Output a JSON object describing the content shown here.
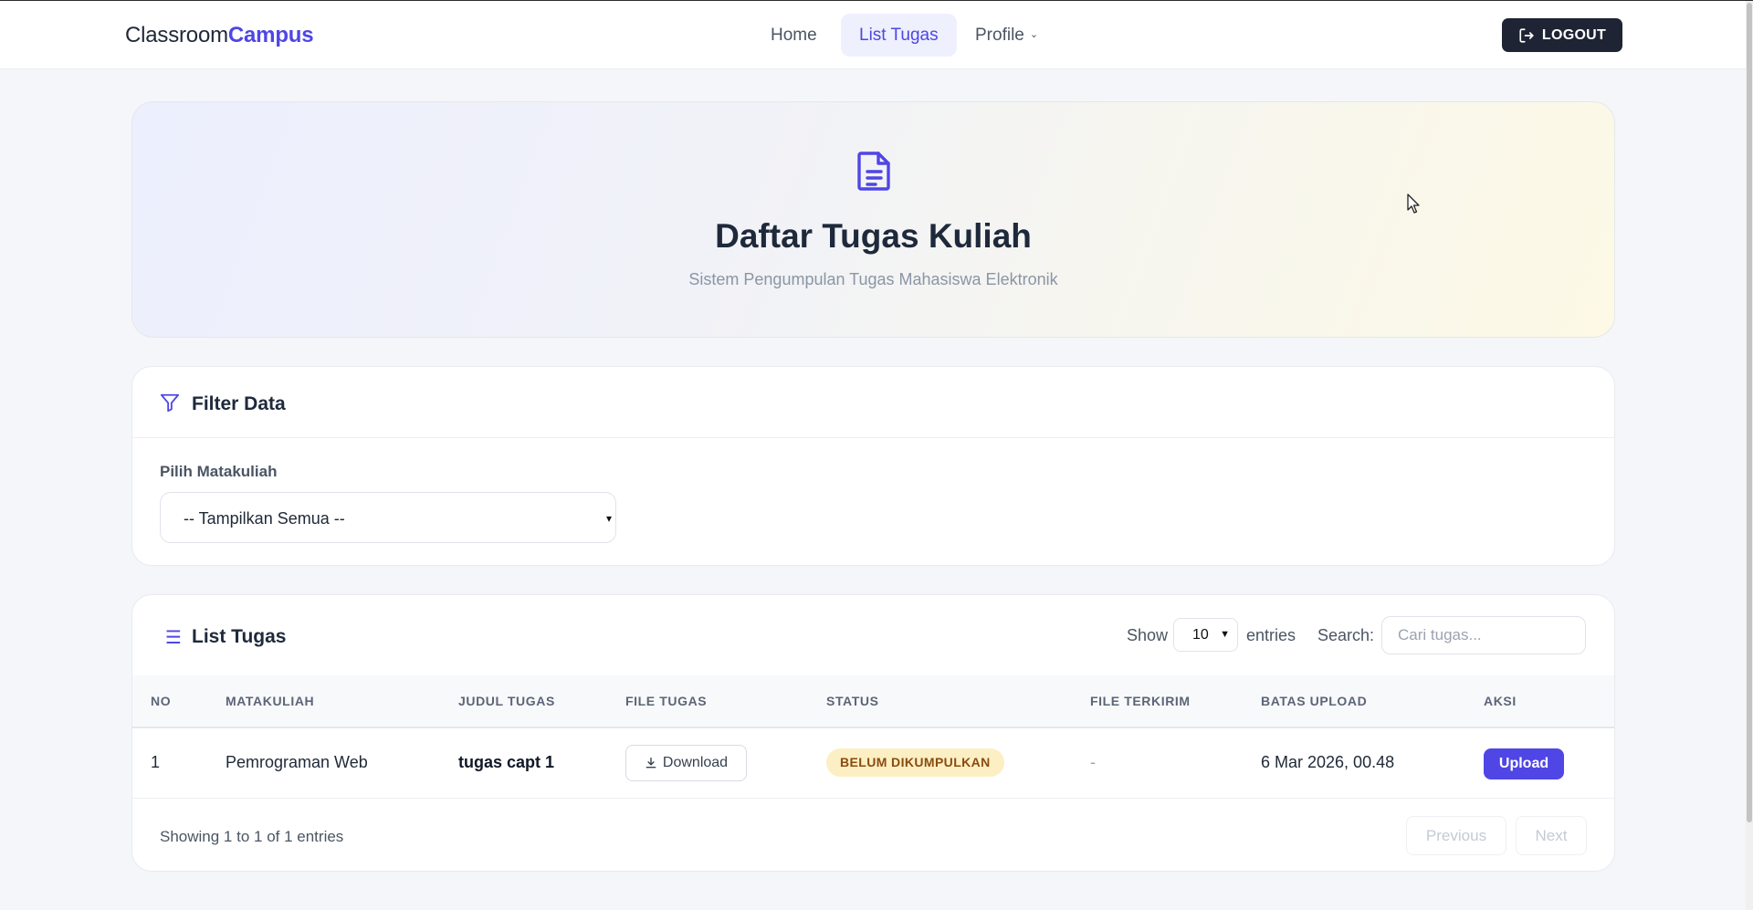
{
  "nav": {
    "brand_a": "Classroom",
    "brand_b": "Campus",
    "home": "Home",
    "list_tugas": "List Tugas",
    "profile": "Profile",
    "logout": "LOGOUT"
  },
  "hero": {
    "title": "Daftar Tugas Kuliah",
    "subtitle": "Sistem Pengumpulan Tugas Mahasiswa Elektronik"
  },
  "filter": {
    "title": "Filter Data",
    "label": "Pilih Matakuliah",
    "selected": "-- Tampilkan Semua --"
  },
  "list": {
    "title": "List Tugas",
    "show_label": "Show",
    "page_size": "10",
    "entries_label": "entries",
    "search_label": "Search:",
    "search_placeholder": "Cari tugas...",
    "columns": [
      "NO",
      "MATAKULIAH",
      "JUDUL TUGAS",
      "FILE TUGAS",
      "STATUS",
      "FILE TERKIRIM",
      "BATAS UPLOAD",
      "AKSI"
    ],
    "rows": [
      {
        "no": "1",
        "matakuliah": "Pemrograman Web",
        "judul": "tugas capt 1",
        "file_label": "Download",
        "status": "BELUM DIKUMPULKAN",
        "file_terkirim": "-",
        "batas": "6 Mar 2026, 00.48",
        "aksi": "Upload"
      }
    ],
    "showing": "Showing 1 to 1 of 1 entries",
    "prev": "Previous",
    "next": "Next"
  },
  "colors": {
    "accent": "#4f46e5",
    "dark": "#1e2433",
    "badge_bg": "#fcefc4",
    "badge_text": "#8a4b0f"
  }
}
